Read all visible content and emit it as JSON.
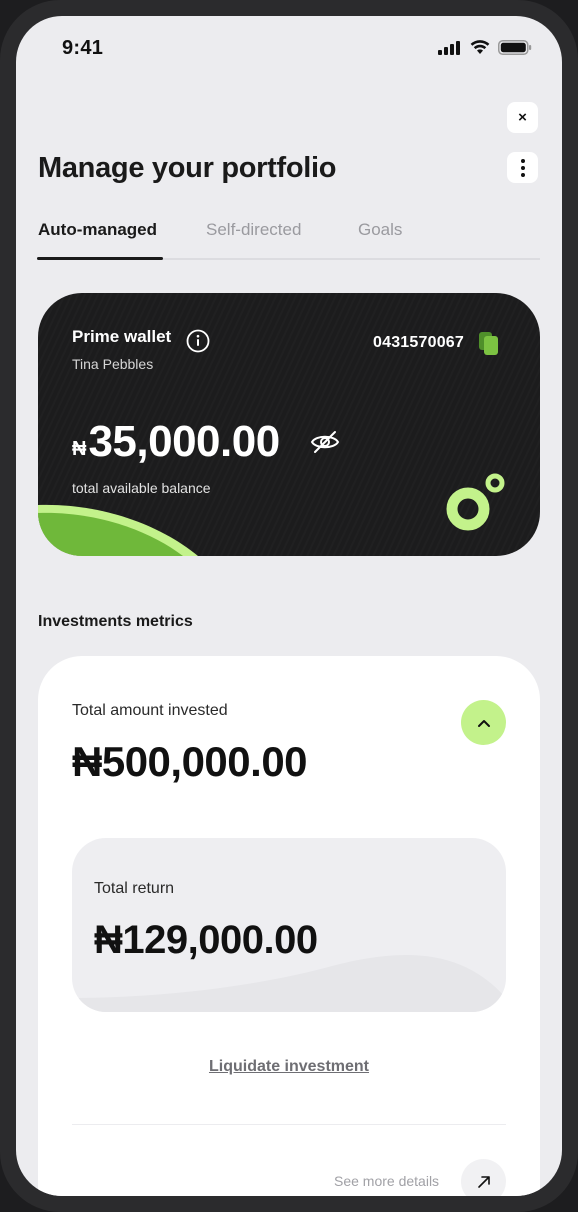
{
  "status_bar": {
    "time": "9:41"
  },
  "header": {
    "title": "Manage your portfolio",
    "close_label": "×"
  },
  "tabs": [
    {
      "label": "Auto-managed",
      "active": true
    },
    {
      "label": "Self-directed",
      "active": false
    },
    {
      "label": "Goals",
      "active": false
    }
  ],
  "wallet": {
    "title": "Prime wallet",
    "owner": "Tina Pebbles",
    "account_number": "0431570067",
    "currency_symbol": "₦",
    "balance": "35,000.00",
    "balance_caption": "total available balance"
  },
  "metrics": {
    "section_title": "Investments metrics",
    "invested_label": "Total amount invested",
    "invested_amount": "₦500,000.00",
    "return_label": "Total return",
    "return_amount": "₦129,000.00",
    "liquidate_label": "Liquidate investment",
    "see_more_label": "See more details"
  },
  "colors": {
    "accent_green": "#c3f28b",
    "brand_green": "#7cc242",
    "card_dark": "#1c1c1d",
    "background": "#ececef"
  }
}
